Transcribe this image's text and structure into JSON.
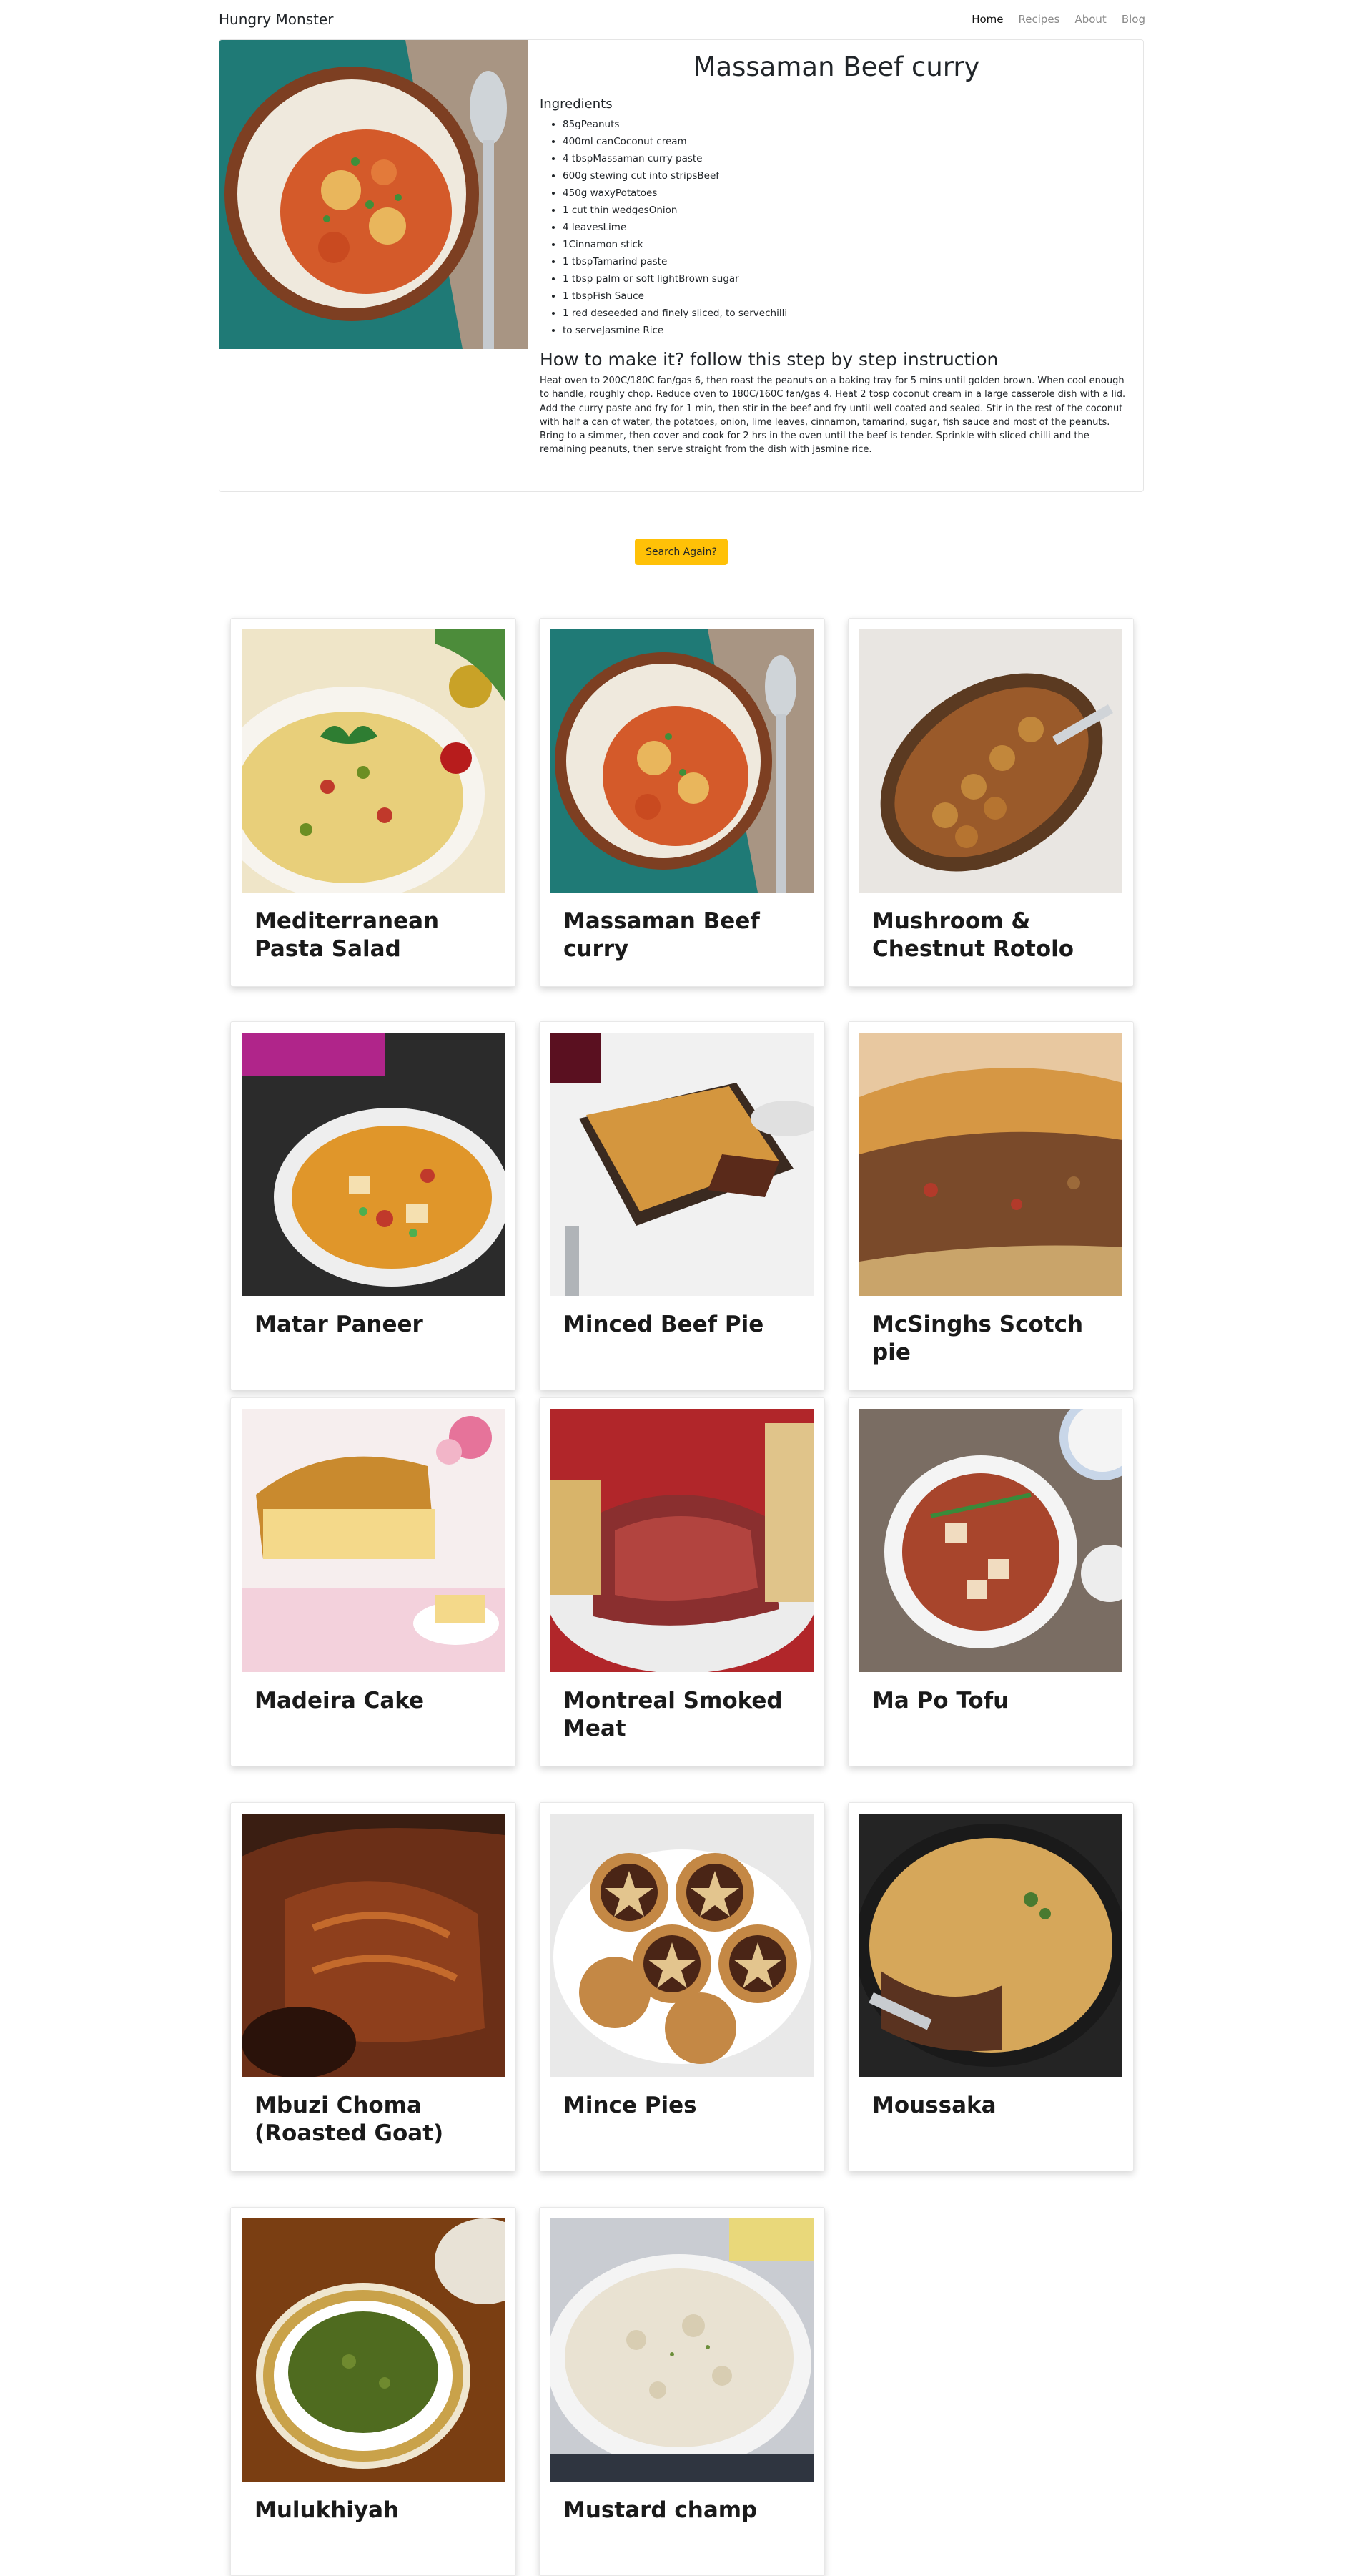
{
  "nav": {
    "brand": "Hungry Monster",
    "links": [
      "Home",
      "Recipes",
      "About",
      "Blog"
    ]
  },
  "detail": {
    "title": "Massaman Beef curry",
    "ingredients_heading": "Ingredients",
    "ingredients": [
      "85gPeanuts",
      "400ml canCoconut cream",
      "4 tbspMassaman curry paste",
      "600g stewing cut into stripsBeef",
      "450g waxyPotatoes",
      "1 cut thin wedgesOnion",
      "4 leavesLime",
      "1Cinnamon stick",
      "1 tbspTamarind paste",
      "1 tbsp palm or soft lightBrown sugar",
      "1 tbspFish Sauce",
      "1 red deseeded and finely sliced, to servechilli",
      "to serveJasmine Rice"
    ],
    "instructions_heading": "How to make it? follow this step by step instruction",
    "instructions": "Heat oven to 200C/180C fan/gas 6, then roast the peanuts on a baking tray for 5 mins until golden brown. When cool enough to handle, roughly chop. Reduce oven to 180C/160C fan/gas 4. Heat 2 tbsp coconut cream in a large casserole dish with a lid. Add the curry paste and fry for 1 min, then stir in the beef and fry until well coated and sealed. Stir in the rest of the coconut with half a can of water, the potatoes, onion, lime leaves, cinnamon, tamarind, sugar, fish sauce and most of the peanuts. Bring to a simmer, then cover and cook for 2 hrs in the oven until the beef is tender. Sprinkle with sliced chilli and the remaining peanuts, then serve straight from the dish with jasmine rice."
  },
  "search_again_label": "Search Again?",
  "meals": [
    {
      "name": "Mediterranean Pasta Salad"
    },
    {
      "name": "Massaman Beef curry"
    },
    {
      "name": "Mushroom & Chestnut Rotolo"
    },
    {
      "name": "Matar Paneer"
    },
    {
      "name": "Minced Beef Pie"
    },
    {
      "name": "McSinghs Scotch pie"
    },
    {
      "name": "Madeira Cake"
    },
    {
      "name": "Montreal Smoked Meat"
    },
    {
      "name": "Ma Po Tofu"
    },
    {
      "name": "Mbuzi Choma (Roasted Goat)"
    },
    {
      "name": "Mince Pies"
    },
    {
      "name": "Moussaka"
    },
    {
      "name": "Mulukhiyah"
    },
    {
      "name": "Mustard champ"
    }
  ]
}
